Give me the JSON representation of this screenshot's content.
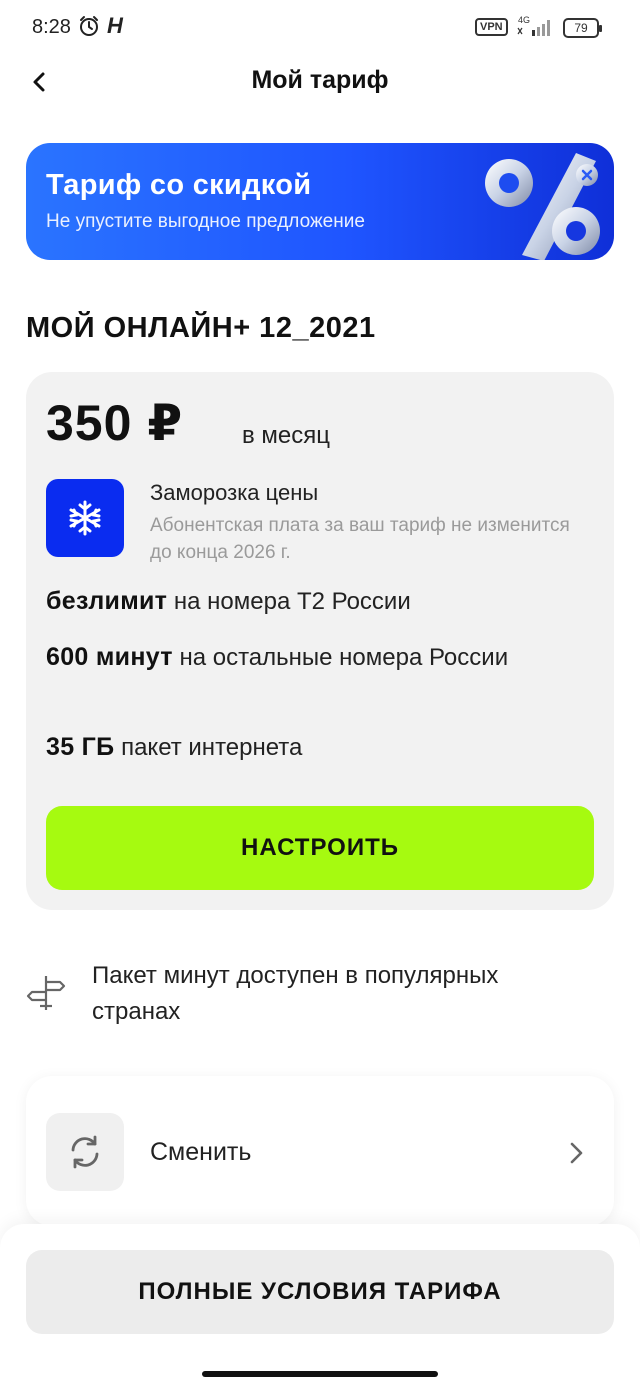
{
  "status_bar": {
    "time": "8:28",
    "h_indicator": "H",
    "vpn": "VPN",
    "network": "4G",
    "battery": "79"
  },
  "header": {
    "title": "Мой тариф"
  },
  "promo": {
    "title": "Тариф со скидкой",
    "subtitle": "Не упустите выгодное предложение",
    "bg_color": "#2a74ff"
  },
  "tariff": {
    "name": "МОЙ ОНЛАЙН+ 12_2021",
    "price": "350 ₽",
    "period": "в месяц",
    "freeze": {
      "title": "Заморозка цены",
      "description": "Абонентская плата за ваш тариф не изменится до конца 2026 г."
    },
    "features": [
      {
        "bold": "безлимит",
        "text": "на номера Т2 России"
      },
      {
        "bold": "600 минут",
        "text": "на остальные номера России"
      },
      {
        "bold": "35 ГБ",
        "text": "пакет интернета"
      }
    ],
    "setup_button": "НАСТРОИТЬ",
    "accent_color": "#a6fa10"
  },
  "roaming": {
    "text": "Пакет минут доступен в популярных странах"
  },
  "change": {
    "label": "Сменить"
  },
  "footer": {
    "terms_button": "ПОЛНЫЕ УСЛОВИЯ ТАРИФА"
  },
  "icons": {
    "back": "chevron-left-icon",
    "alarm": "alarm-icon",
    "freeze": "snowflake-icon",
    "roaming": "signpost-icon",
    "change": "refresh-icon",
    "chevron": "chevron-right-icon"
  }
}
